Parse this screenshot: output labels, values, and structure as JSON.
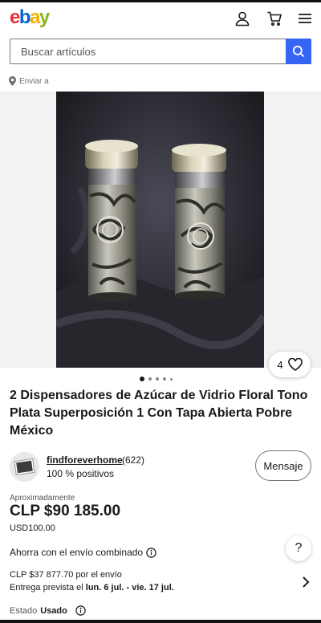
{
  "brand": {
    "logo_letters": [
      "e",
      "b",
      "a",
      "y"
    ],
    "logo_colors": [
      "#e53238",
      "#0064d2",
      "#f5af02",
      "#86b817"
    ]
  },
  "header": {
    "icons": [
      "account-icon",
      "cart-icon",
      "menu-icon"
    ]
  },
  "search": {
    "placeholder": "Buscar artículos",
    "button_icon": "search-icon",
    "accent_color": "#3665f3"
  },
  "ship_to": {
    "label": "Enviar a",
    "icon": "location-pin-icon"
  },
  "gallery": {
    "watch_count": "4",
    "watch_icon": "heart-icon",
    "total_dots": 5,
    "active_dot": 0
  },
  "listing": {
    "title": "2 Dispensadores de Azúcar de Vidrio Floral Tono Plata Superposición 1 Con Tapa Abierta Pobre México"
  },
  "seller": {
    "name": "findforeverhome",
    "count": "(622)",
    "feedback": "100 % positivos",
    "message_label": "Mensaje"
  },
  "pricing": {
    "approx_label": "Aproximadamente",
    "price": "CLP $90 185.00",
    "price_usd": "USD100.00"
  },
  "shipping": {
    "combined_label": "Ahorra con el envío combinado",
    "cost": "CLP $37 877.70 por el envío",
    "delivery_prefix": "Entrega prevista el",
    "delivery_dates": "lun. 6 jul. - vie. 17 jul."
  },
  "condition": {
    "label": "Estado",
    "value": "Usado"
  },
  "help": {
    "label": "?"
  }
}
